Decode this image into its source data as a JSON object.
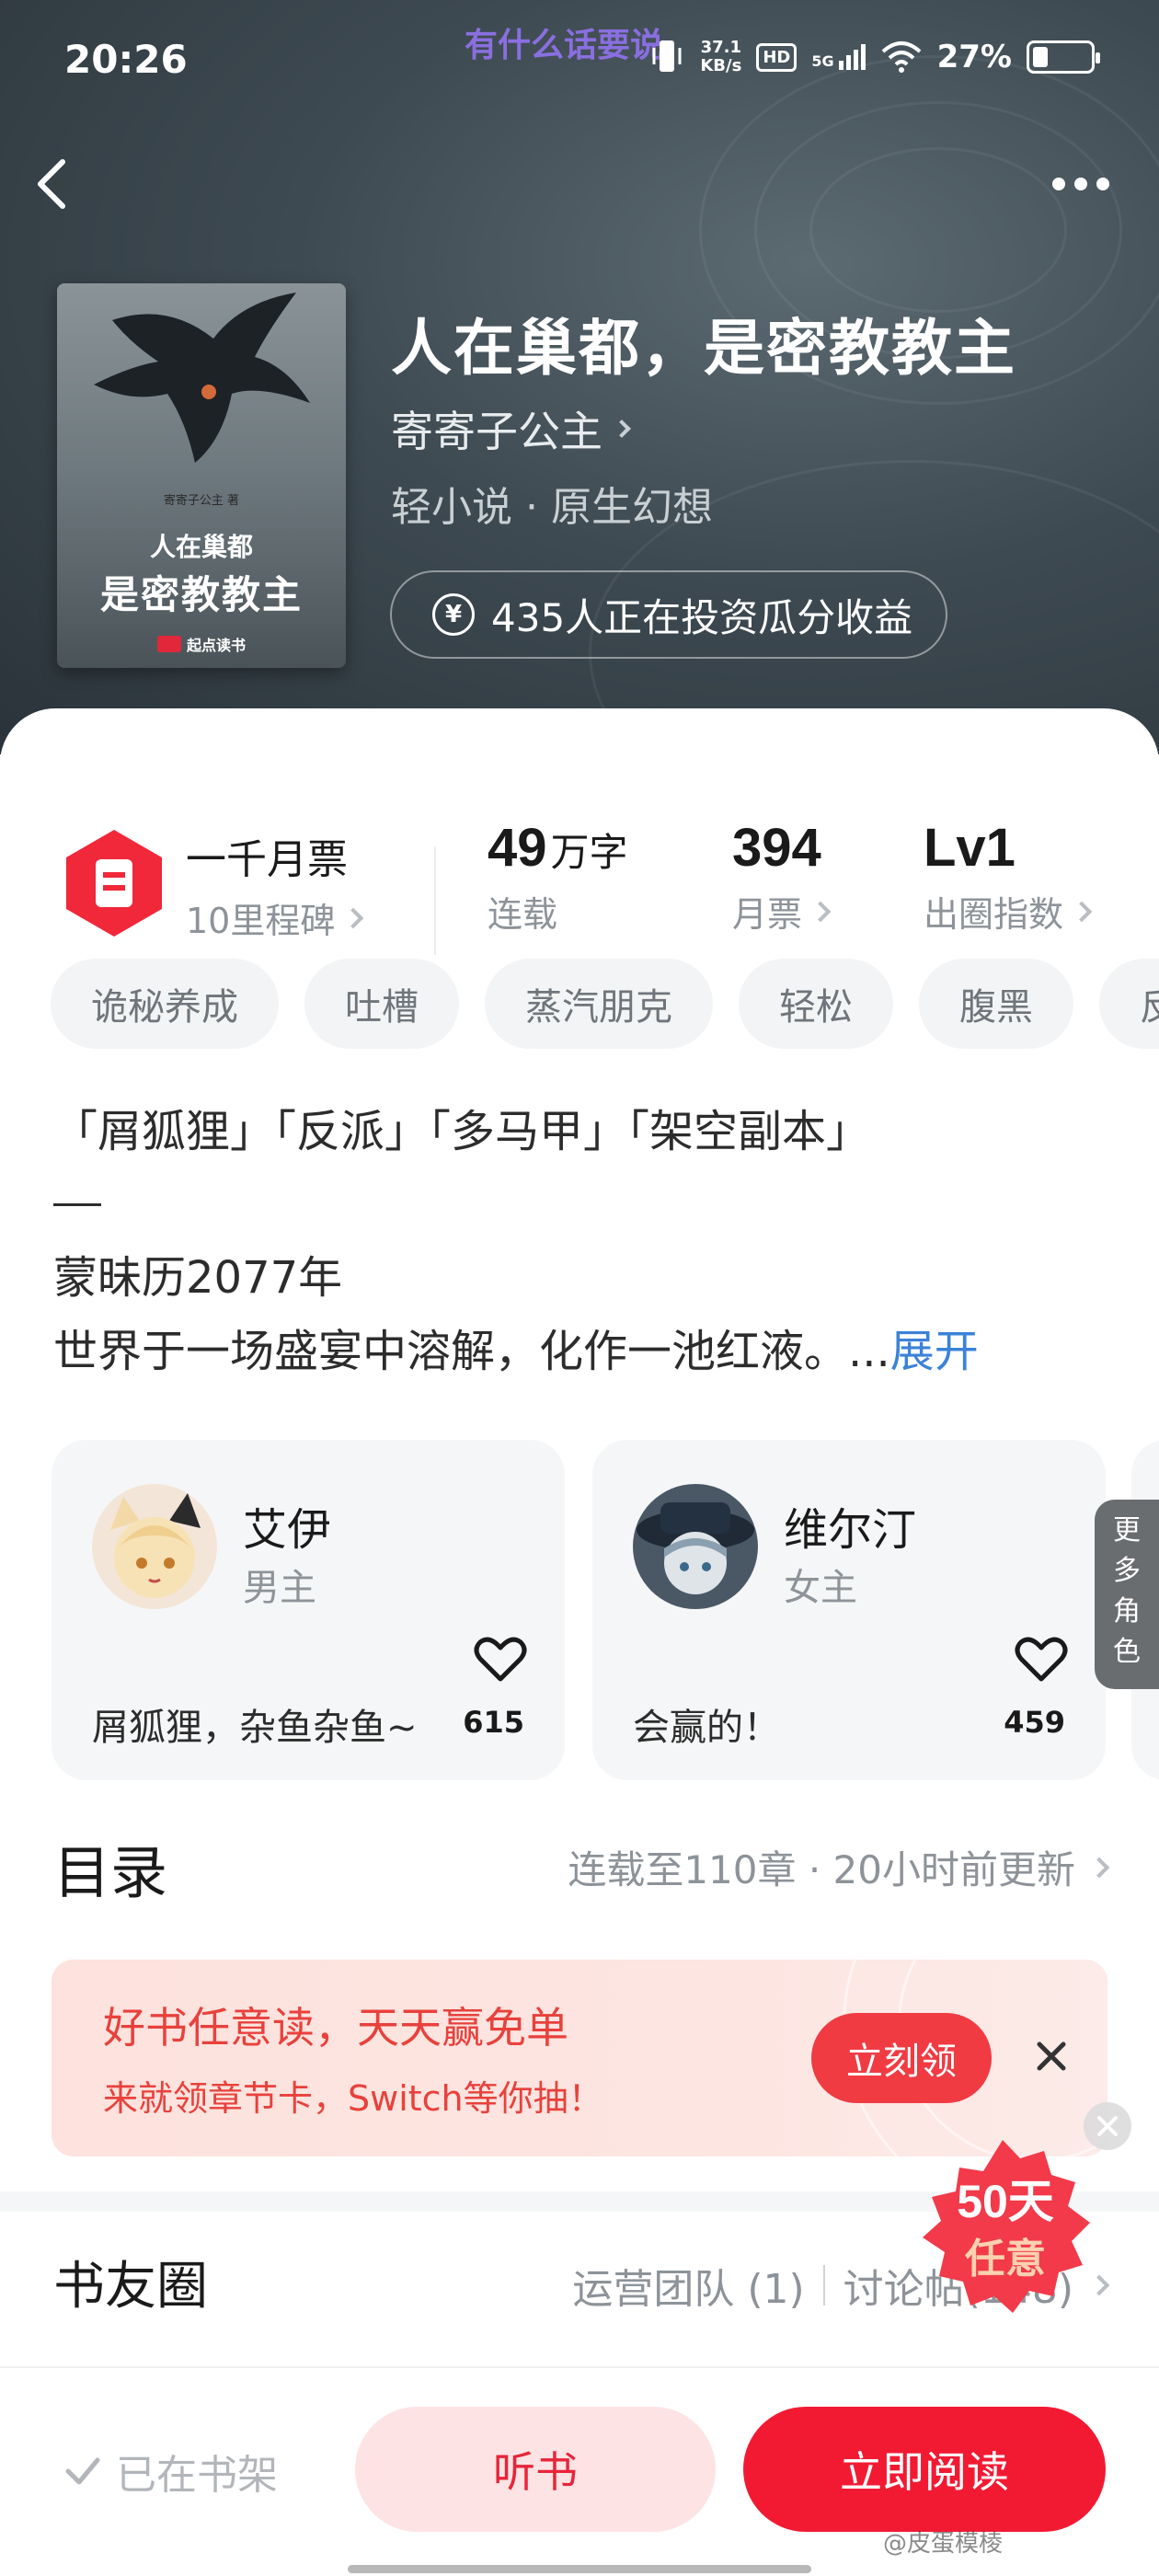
{
  "status_bar": {
    "time": "20:26",
    "marquee": "有什么话要说",
    "net_speed_value": "37.1",
    "net_speed_unit": "KB/s",
    "hd": "HD",
    "signal": "5G",
    "battery": "27%"
  },
  "book": {
    "title": "人在巢都，是密教教主",
    "author": "寄寄子公主",
    "genre": "轻小说 · 原生幻想",
    "invest": "435人正在投资瓜分收益",
    "cover": {
      "author_line": "寄寄子公主 著",
      "line1": "人在巢都",
      "line2": "是密教教主",
      "publisher": "起点读书"
    }
  },
  "stats": {
    "ticket_title": "一千月票",
    "ticket_sub": "10里程碑",
    "words_value": "49",
    "words_unit": "万字",
    "words_label": "连载",
    "monthly_value": "394",
    "monthly_label": "月票",
    "level_value": "Lv1",
    "level_label": "出圈指数"
  },
  "tags": [
    "诡秘养成",
    "吐槽",
    "蒸汽朋克",
    "轻松",
    "腹黑",
    "反"
  ],
  "description": {
    "line1": "「屑狐狸」「反派」「多马甲」「架空副本」",
    "line2": "蒙昧历2077年",
    "line3": "世界于一场盛宴中溶解，化作一池红液。...",
    "expand": "展开"
  },
  "characters": [
    {
      "name": "艾伊",
      "role": "男主",
      "quote": "屑狐狸，杂鱼杂鱼~",
      "likes": "615"
    },
    {
      "name": "维尔汀",
      "role": "女主",
      "quote": "会赢的！",
      "likes": "459"
    }
  ],
  "more_roles": [
    "更",
    "多",
    "角",
    "色"
  ],
  "toc": {
    "title": "目录",
    "meta": "连载至110章 · 20小时前更新"
  },
  "promo": {
    "title": "好书任意读，天天赢免单",
    "subtitle": "来就领章节卡，Switch等你抽！",
    "button": "立刻领"
  },
  "badge": {
    "line1": "50天",
    "line2": "任意"
  },
  "circle": {
    "title": "书友圈",
    "ops": "运营团队 (1)",
    "posts": "讨论帖(148)"
  },
  "bottom": {
    "shelf": "已在书架",
    "listen": "听书",
    "read": "立即阅读",
    "watermark": "@皮蛋模棱"
  },
  "colors": {
    "accent_red": "#f21a33",
    "link_blue": "#3b82d8",
    "header_bg": "#3e4a52"
  }
}
